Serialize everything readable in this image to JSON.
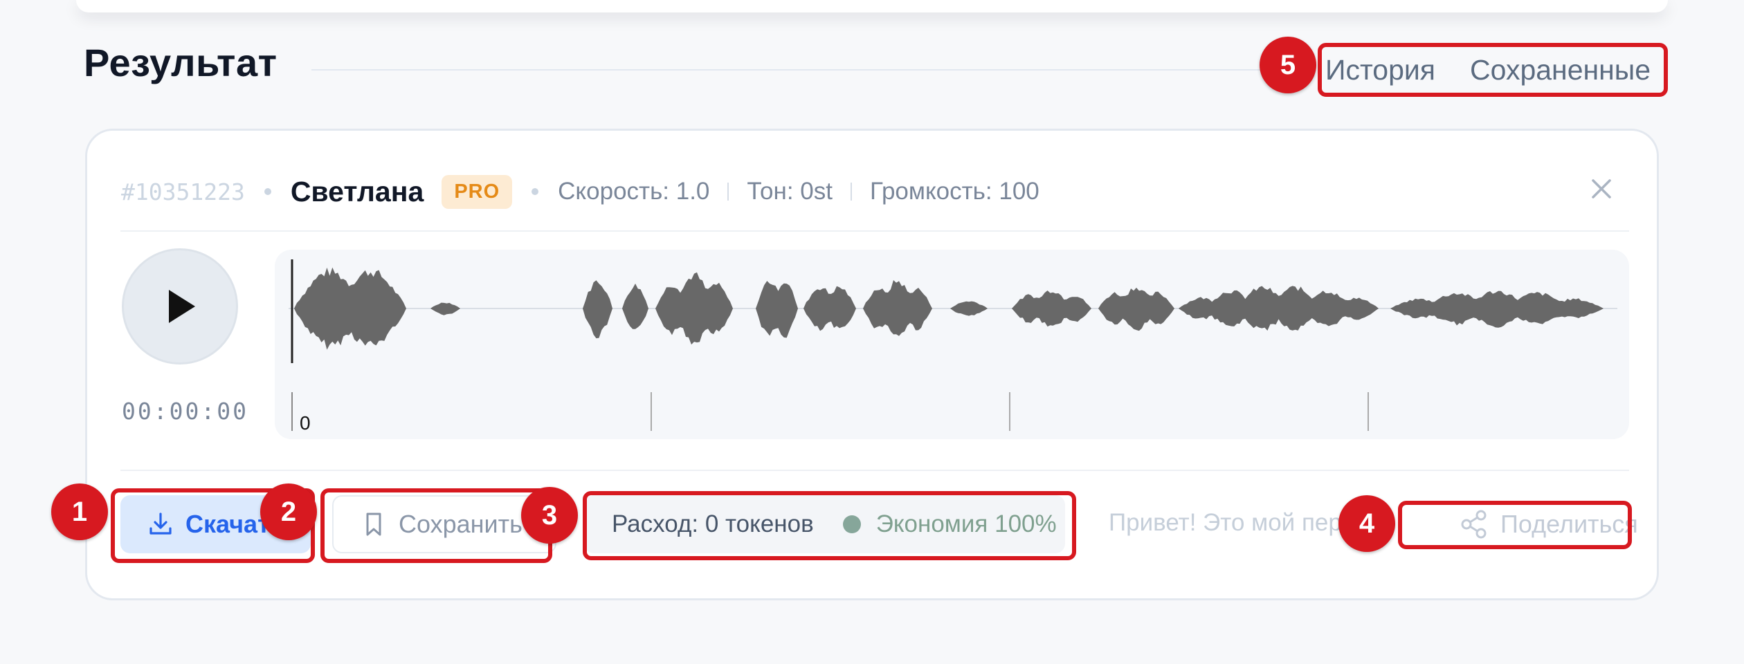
{
  "section": {
    "title": "Результат",
    "tabs": [
      "История",
      "Сохраненные"
    ]
  },
  "card": {
    "id": "#10351223",
    "voice_name": "Светлана",
    "badge": "PRO",
    "params": {
      "speed": "Скорость: 1.0",
      "tone": "Тон: 0st",
      "volume": "Громкость: 100"
    },
    "player": {
      "time": "00:00:00",
      "timeline_start_label": "0"
    },
    "actions": {
      "download": "Скачать",
      "save": "Сохранить",
      "cost": "Расход: 0 токенов",
      "economy": "Экономия 100%",
      "preview": "Привет! Это мой первый",
      "share": "Поделиться"
    }
  },
  "annotations": [
    "1",
    "2",
    "3",
    "4",
    "5"
  ],
  "colors": {
    "accent": "#2563eb",
    "annotation": "#d71920",
    "pro_badge": "#e58a17",
    "economy": "#86a69a"
  }
}
